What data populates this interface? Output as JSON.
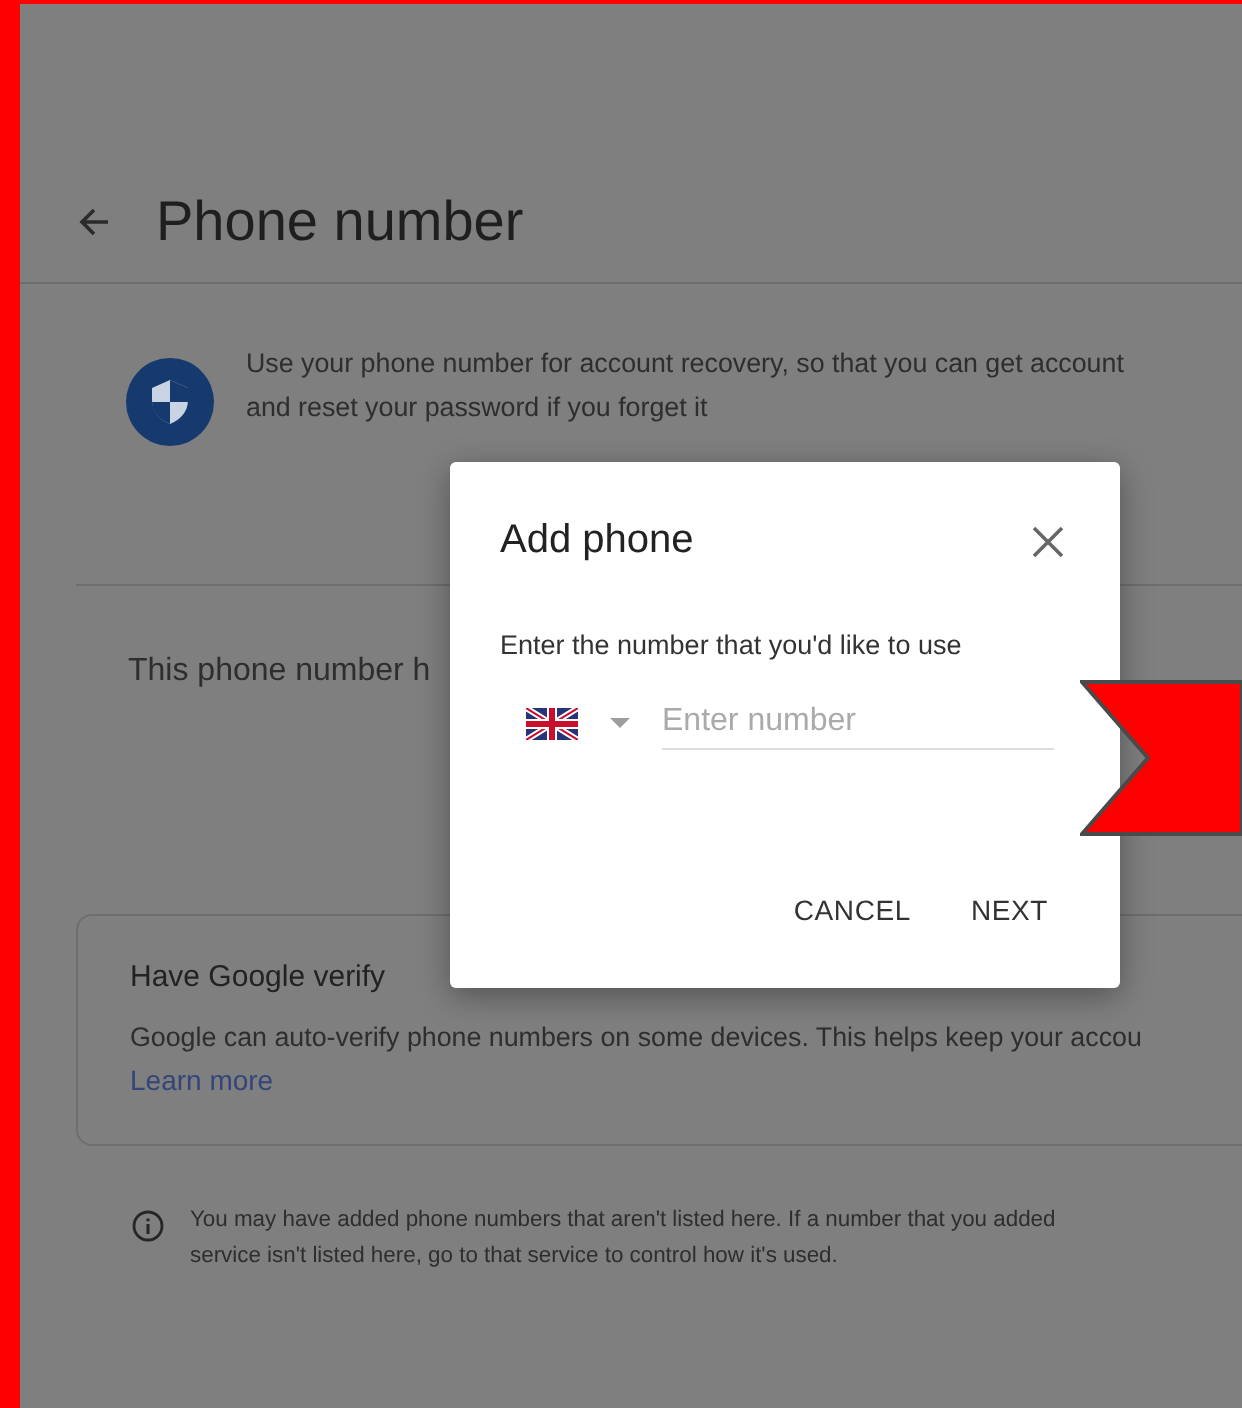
{
  "page": {
    "title": "Phone number",
    "intro_lines": [
      "Use your phone number for account recovery, so that you can get account",
      "and reset your password if you forget it"
    ],
    "status_text": "This phone number h",
    "verify_card": {
      "title": "Have Google verify",
      "text": "Google can auto-verify phone numbers on some devices. This helps keep your accou",
      "link": "Learn more"
    },
    "note_lines": [
      "You may have added phone numbers that aren't listed here. If a number that you added",
      "service isn't listed here, go to that service to control how it's used."
    ]
  },
  "dialog": {
    "title": "Add phone",
    "prompt": "Enter the number that you'd like to use",
    "phone_field": {
      "placeholder": "Enter number"
    },
    "buttons": [
      "CANCEL",
      "NEXT"
    ]
  }
}
